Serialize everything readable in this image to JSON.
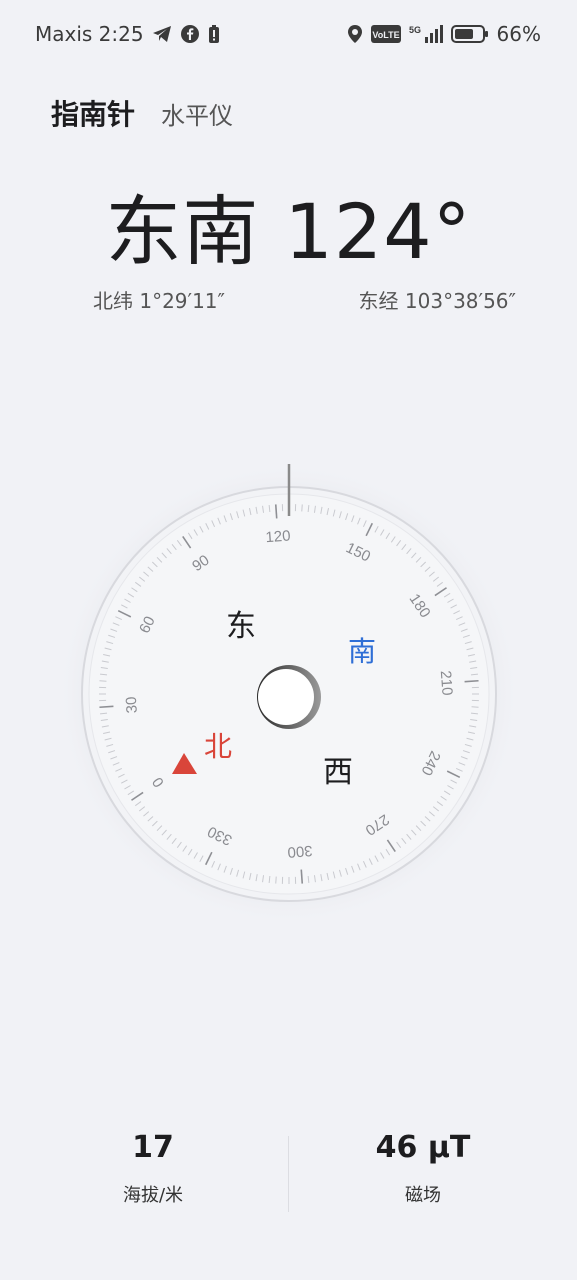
{
  "status": {
    "carrier_time": "Maxis 2:25",
    "battery": "66%",
    "network": "5G",
    "volte": "VoLTE",
    "icons": [
      "telegram-icon",
      "facebook-icon",
      "battery-saver-icon",
      "location-icon",
      "volte-icon",
      "signal-icon",
      "battery-icon"
    ]
  },
  "tabs": {
    "compass": "指南针",
    "level": "水平仪"
  },
  "heading": "东南 124°",
  "coordinates": {
    "latitude": "北纬 1°29′11″",
    "longitude": "东经 103°38′56″"
  },
  "dial": {
    "cardinals": {
      "east": "东",
      "south": "南",
      "north": "北",
      "west": "西"
    },
    "colors": {
      "north": "#d9453a",
      "south": "#2f6fd6"
    },
    "degree_labels": [
      "0",
      "30",
      "60",
      "90",
      "120",
      "150",
      "180",
      "210",
      "240",
      "270",
      "300",
      "330"
    ],
    "heading_degrees": 124
  },
  "metrics": {
    "altitude_value": "17",
    "altitude_label": "海拔/米",
    "field_value": "46 μT",
    "field_label": "磁场"
  }
}
